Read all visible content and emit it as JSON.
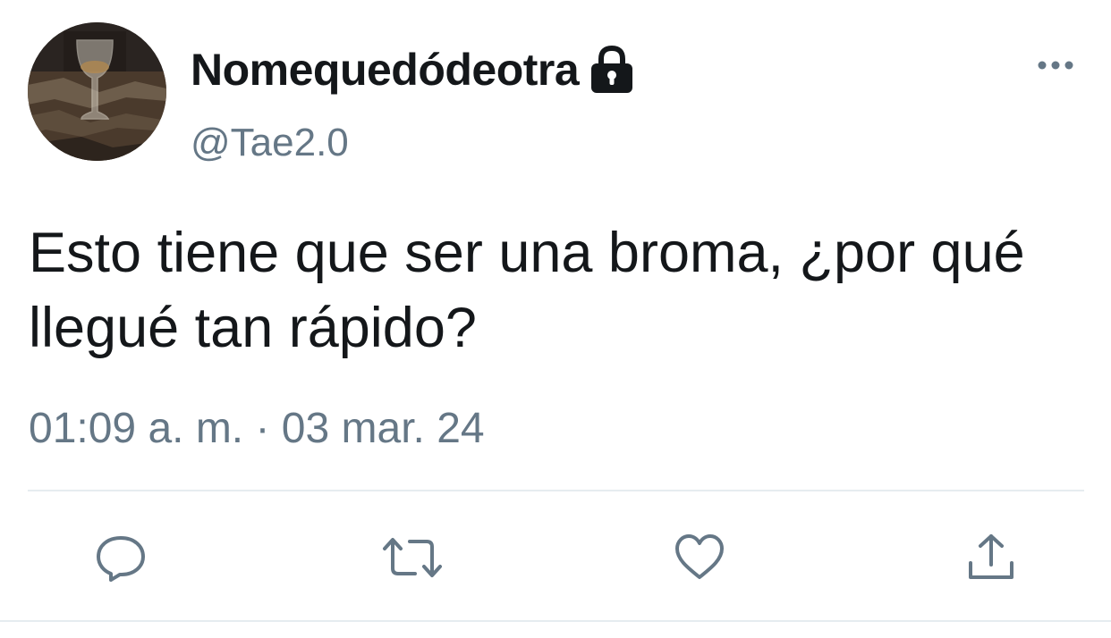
{
  "tweet": {
    "author": {
      "display_name": "Nomequedódeotra",
      "handle": "@Tae2.0",
      "protected_icon": "lock-icon",
      "avatar": "profile-photo-wine-glass"
    },
    "text": "Esto tiene que ser una broma, ¿por qué llegué tan rápido?",
    "timestamp": "01:09 a. m. · 03 mar. 24",
    "menu_icon": "more-icon"
  },
  "actions": [
    {
      "name": "reply",
      "icon": "reply-icon"
    },
    {
      "name": "retweet",
      "icon": "retweet-icon"
    },
    {
      "name": "like",
      "icon": "heart-icon"
    },
    {
      "name": "share",
      "icon": "share-icon"
    }
  ],
  "colors": {
    "text_primary": "#14171a",
    "text_secondary": "#657786",
    "divider": "#e6ecf0"
  }
}
